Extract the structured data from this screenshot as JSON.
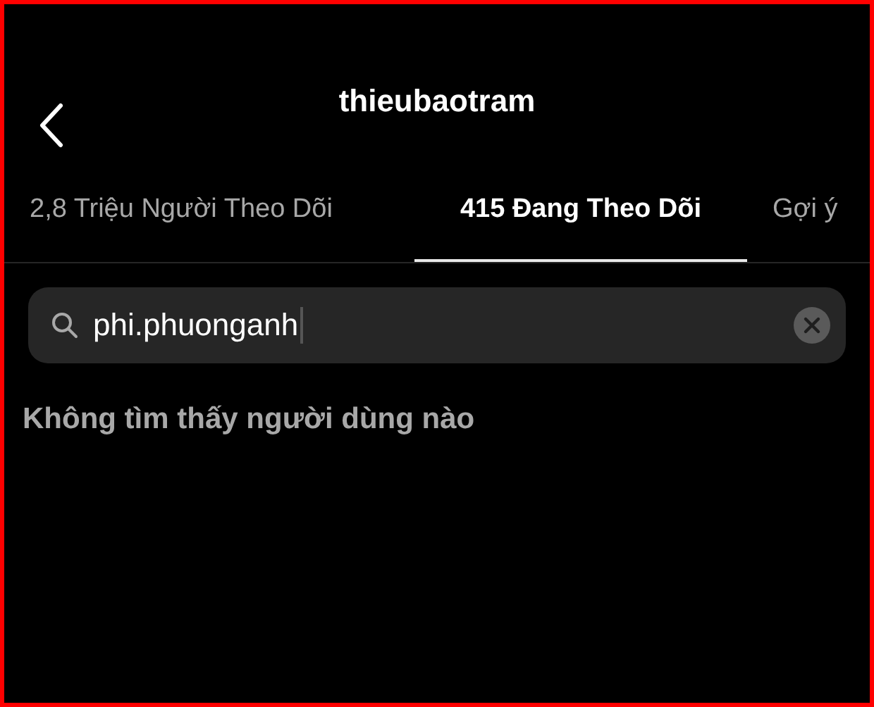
{
  "header": {
    "title": "thieubaotram"
  },
  "tabs": [
    {
      "label": "2,8 Triệu Người Theo Dõi",
      "selected": false
    },
    {
      "label": "415 Đang Theo Dõi",
      "selected": true
    },
    {
      "label": "Gợi ý",
      "selected": false
    }
  ],
  "search": {
    "value": "phi.phuonganh"
  },
  "message": "Không tìm thấy người dùng nào"
}
